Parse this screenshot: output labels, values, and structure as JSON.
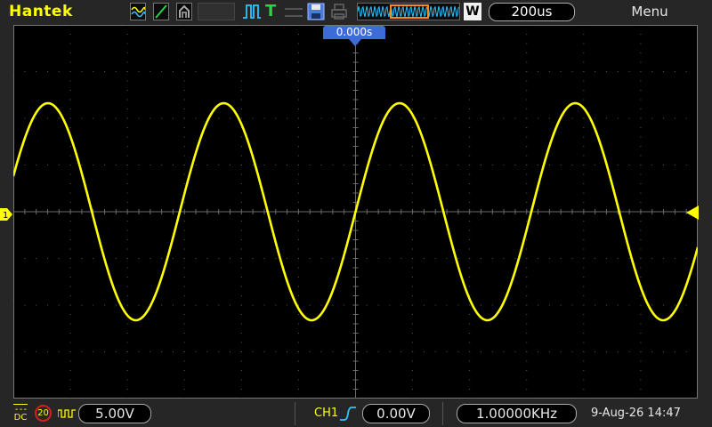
{
  "top_bar": {
    "brand": "Hantek",
    "acquire_mode_icon": "wave-average-icon",
    "display_vector_icon": "vector-display-icon",
    "persist_icon": "persist-icon",
    "trigger_status_icon": "trigger-status-icon",
    "trigger_state": "T",
    "probe_icon": "probe-icon",
    "save_icon": "floppy-save-icon",
    "print_icon": "print-icon",
    "window_mode": "W",
    "timebase": "200us",
    "menu_label": "Menu"
  },
  "screen": {
    "trigger_time": "0.000s",
    "channel_marker": "1",
    "trace_color": "#ffff00",
    "trigger_marker_color": "#3d6bd8"
  },
  "bottom_bar": {
    "coupling": "DC",
    "bandwidth_limit": "20",
    "volts_per_div": "5.00V",
    "trigger_source": "CH1",
    "trigger_slope": "rising",
    "trigger_level": "0.00V",
    "frequency": "1.00000KHz",
    "datetime": "9-Aug-26 14:47"
  }
}
